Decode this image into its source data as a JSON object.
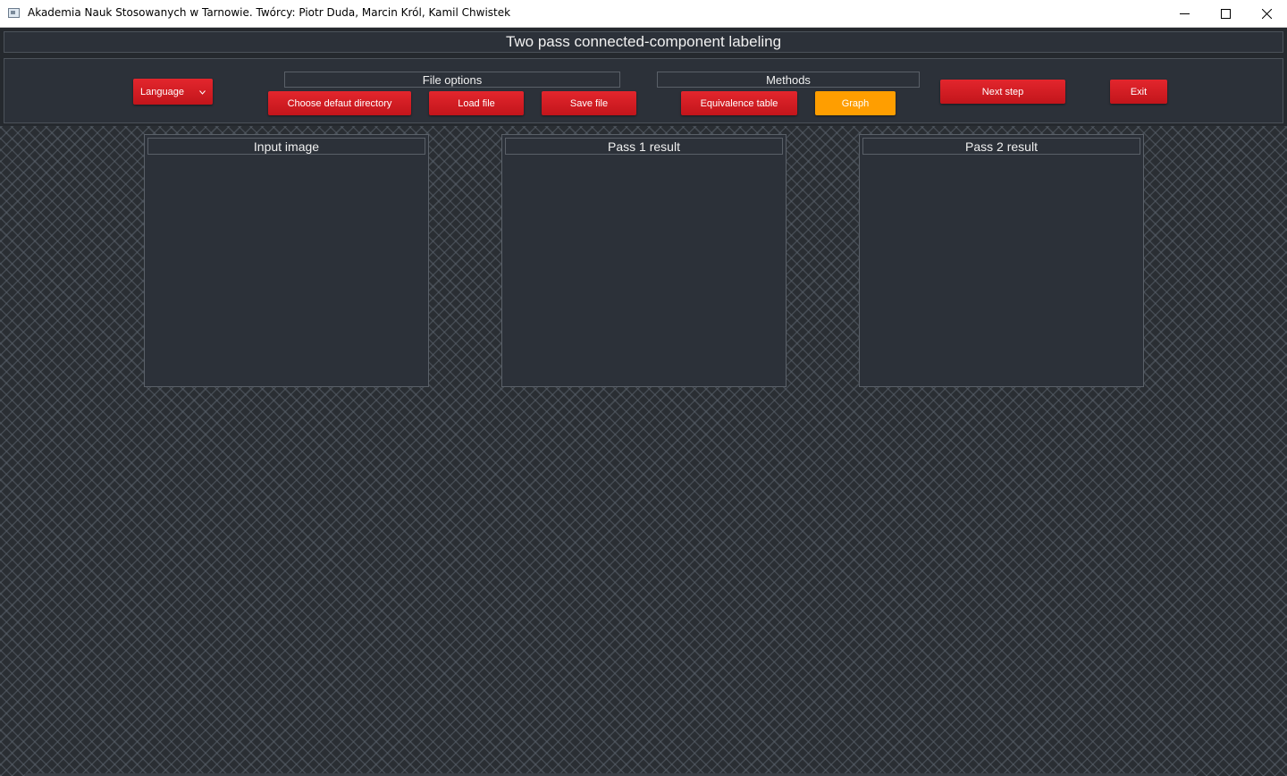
{
  "window": {
    "title": "Akademia Nauk Stosowanych w Tarnowie. Twórcy: Piotr Duda, Marcin Król, Kamil Chwistek",
    "controls": [
      "minimize-icon",
      "maximize-icon",
      "close-icon"
    ]
  },
  "header": {
    "title": "Two pass connected-component labeling"
  },
  "toolbar": {
    "language_label": "Language",
    "file_options": {
      "label": "File options",
      "choose_directory": "Choose defaut directory",
      "load_file": "Load file",
      "save_file": "Save file"
    },
    "methods": {
      "label": "Methods",
      "equivalence_table": "Equivalence table",
      "graph": "Graph"
    },
    "next_step": "Next step",
    "exit": "Exit"
  },
  "panels": {
    "input": "Input image",
    "pass1": "Pass 1 result",
    "pass2": "Pass 2 result"
  },
  "colors": {
    "accent_red": "#d81e24",
    "accent_orange": "#ff9e00",
    "panel_bg": "#2c3139",
    "text": "#f0f0f0"
  }
}
